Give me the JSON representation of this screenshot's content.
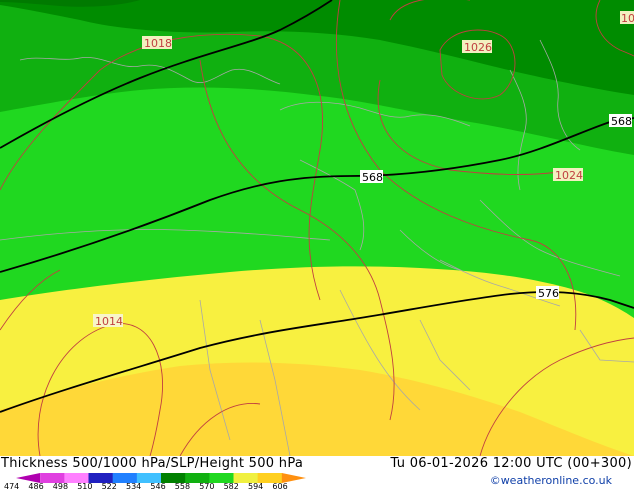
{
  "title": "Thickness 500/1000 hPa/SLP/Height 500 hPa",
  "datetime": "Tu 06-01-2026 12:00 UTC (00+300)",
  "credit": "©weatheronline.co.uk",
  "isobar_labels": [
    "1018",
    "1026",
    "1024",
    "1014",
    "10"
  ],
  "height_labels": [
    "568",
    "568",
    "576"
  ],
  "legend": {
    "values": [
      "474",
      "486",
      "498",
      "510",
      "522",
      "534",
      "546",
      "558",
      "570",
      "582",
      "594",
      "606"
    ],
    "colors": [
      "#b000b0",
      "#e040e0",
      "#ff80ff",
      "#2020c0",
      "#2080ff",
      "#40c0ff",
      "#008000",
      "#10b010",
      "#20d820",
      "#f0f040",
      "#ffd020",
      "#ff9010"
    ]
  },
  "colors": {
    "band_558": "#10b010",
    "band_570": "#20d820",
    "band_582": "#f8f040",
    "band_594": "#ffd838",
    "band_546": "#008c00",
    "isobar": "#c04040",
    "height_contour": "#000000",
    "coastline": "#a8a8a8"
  }
}
